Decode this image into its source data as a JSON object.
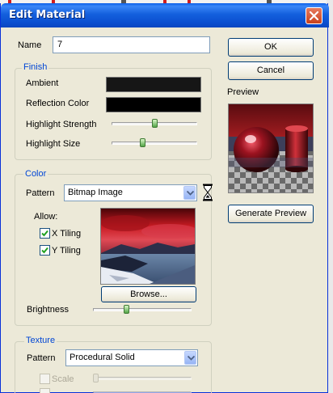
{
  "window": {
    "title": "Edit Material"
  },
  "name_field": {
    "label": "Name",
    "value": "7"
  },
  "buttons": {
    "ok": "OK",
    "cancel": "Cancel",
    "generate_preview": "Generate Preview",
    "browse": "Browse..."
  },
  "preview": {
    "label": "Preview"
  },
  "finish": {
    "title": "Finish",
    "ambient_label": "Ambient",
    "ambient_color": "#161616",
    "reflection_label": "Reflection Color",
    "reflection_color": "#000000",
    "highlight_strength_label": "Highlight Strength",
    "highlight_strength_value": 0.5,
    "highlight_size_label": "Highlight Size",
    "highlight_size_value": 0.35
  },
  "color": {
    "title": "Color",
    "pattern_label": "Pattern",
    "pattern_value": "Bitmap Image",
    "allow_label": "Allow:",
    "x_tiling_label": "X Tiling",
    "x_tiling_checked": true,
    "y_tiling_label": "Y Tiling",
    "y_tiling_checked": true,
    "brightness_label": "Brightness",
    "brightness_value": 0.33
  },
  "texture": {
    "title": "Texture",
    "pattern_label": "Pattern",
    "pattern_value": "Procedural Solid",
    "scale_label": "Scale",
    "scale_checked": false
  },
  "icons": {
    "close": "close-icon",
    "dropdown": "chevron-down-icon",
    "hourglass": "hourglass-icon",
    "check": "check-icon"
  }
}
